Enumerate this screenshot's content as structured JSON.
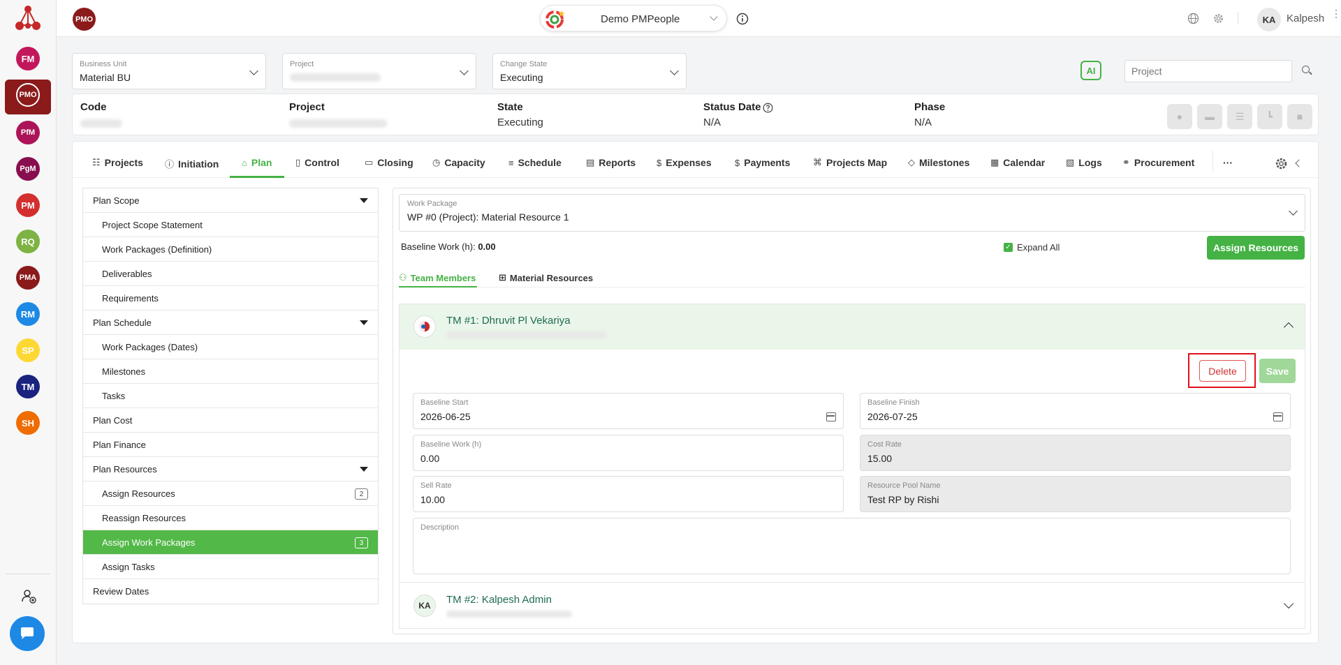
{
  "sidebar": {
    "items": [
      {
        "label": "FM",
        "color": "#c2185b"
      },
      {
        "label": "PMO",
        "color": "#8b1a1a"
      },
      {
        "label": "PfM",
        "color": "#ad1457"
      },
      {
        "label": "PgM",
        "color": "#880e4f"
      },
      {
        "label": "PM",
        "color": "#d32f2f"
      },
      {
        "label": "RQ",
        "color": "#7cb342"
      },
      {
        "label": "PMA",
        "color": "#8b1a1a"
      },
      {
        "label": "RM",
        "color": "#1e88e5"
      },
      {
        "label": "SP",
        "color": "#fdd835"
      },
      {
        "label": "TM",
        "color": "#1a237e"
      },
      {
        "label": "SH",
        "color": "#ef6c00"
      }
    ],
    "user_add_icon": "user-add-icon",
    "chat_icon": "chat-icon"
  },
  "topbar": {
    "module_badge": "PMO",
    "company_name": "Demo PMPeople",
    "user_initials": "KA",
    "user_name": "Kalpesh"
  },
  "filters": {
    "business_unit": {
      "label": "Business Unit",
      "value": "Material BU"
    },
    "project": {
      "label": "Project",
      "value": ""
    },
    "change_state": {
      "label": "Change State",
      "value": "Executing"
    },
    "ai_label": "AI",
    "search_placeholder": "Project"
  },
  "info": {
    "code_label": "Code",
    "project_label": "Project",
    "state_label": "State",
    "state_value": "Executing",
    "status_date_label": "Status Date",
    "status_date_value": "N/A",
    "phase_label": "Phase",
    "phase_value": "N/A"
  },
  "tabs": [
    "Projects",
    "Initiation",
    "Plan",
    "Control",
    "Closing",
    "Capacity",
    "Schedule",
    "Reports",
    "Expenses",
    "Payments",
    "Projects Map",
    "Milestones",
    "Calendar",
    "Logs",
    "Procurement"
  ],
  "tabs_more": "···",
  "nav": {
    "plan_scope": "Plan Scope",
    "project_scope_statement": "Project Scope Statement",
    "work_packages_definition": "Work Packages (Definition)",
    "deliverables": "Deliverables",
    "requirements": "Requirements",
    "plan_schedule": "Plan Schedule",
    "work_packages_dates": "Work Packages (Dates)",
    "milestones": "Milestones",
    "tasks": "Tasks",
    "plan_cost": "Plan Cost",
    "plan_finance": "Plan Finance",
    "plan_resources": "Plan Resources",
    "assign_resources": "Assign Resources",
    "assign_resources_count": "2",
    "reassign_resources": "Reassign Resources",
    "assign_work_packages": "Assign Work Packages",
    "assign_work_packages_count": "3",
    "assign_tasks": "Assign Tasks",
    "review_dates": "Review Dates"
  },
  "content": {
    "work_package_label": "Work Package",
    "work_package_value": "WP #0 (Project): Material Resource 1",
    "baseline_work_label": "Baseline Work (h):",
    "baseline_work_value": "0.00",
    "expand_all": "Expand All",
    "assign_resources_btn": "Assign Resources",
    "subtab_team": "Team Members",
    "subtab_material": "Material Resources",
    "tm1": {
      "name": "TM #1: Dhruvit Pl Vekariya",
      "delete": "Delete",
      "save": "Save",
      "baseline_start_label": "Baseline Start",
      "baseline_start": "2026-06-25",
      "baseline_finish_label": "Baseline Finish",
      "baseline_finish": "2026-07-25",
      "baseline_work_label": "Baseline Work (h)",
      "baseline_work": "0.00",
      "cost_rate_label": "Cost Rate",
      "cost_rate": "15.00",
      "sell_rate_label": "Sell Rate",
      "sell_rate": "10.00",
      "pool_label": "Resource Pool Name",
      "pool_name": "Test RP by Rishi",
      "description_label": "Description"
    },
    "tm2": {
      "initials": "KA",
      "name": "TM #2: Kalpesh Admin"
    }
  },
  "colors": {
    "accent_green": "#44b244",
    "brand_red": "#8b1a1a",
    "highlight_red": "#e0101a"
  }
}
